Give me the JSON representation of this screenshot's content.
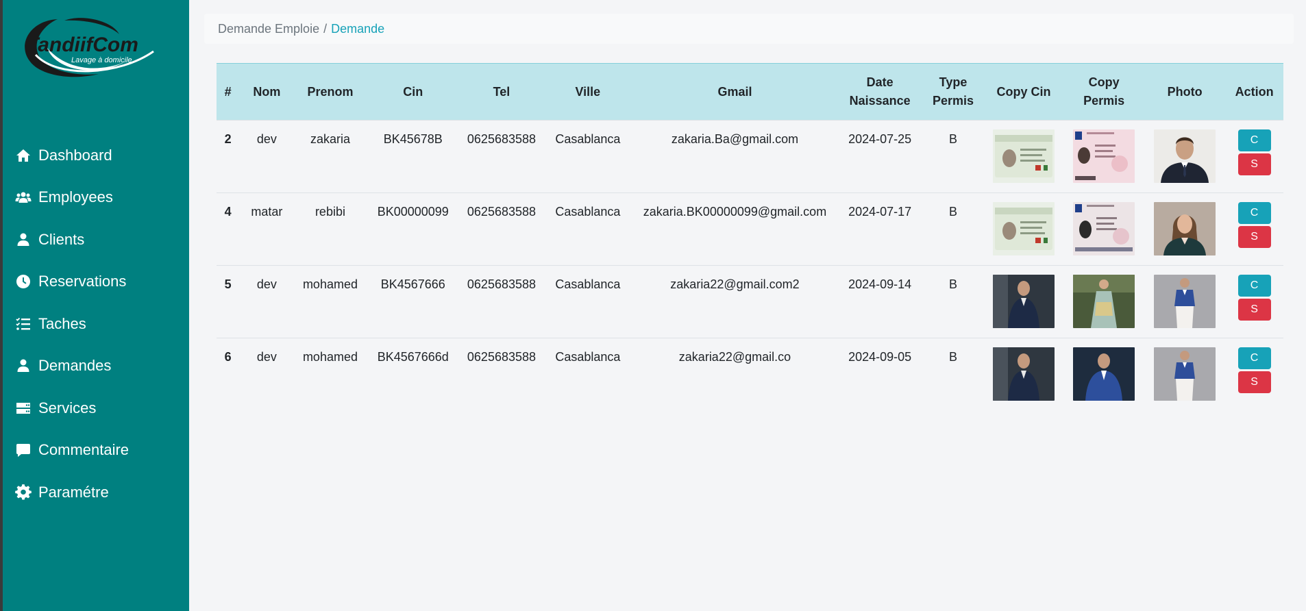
{
  "app": {
    "logo_text": "TandiifCom",
    "logo_tagline": "Lavage à domicile"
  },
  "sidebar": {
    "items": [
      {
        "label": "Dashboard",
        "icon": "home-icon"
      },
      {
        "label": "Employees",
        "icon": "users-icon"
      },
      {
        "label": "Clients",
        "icon": "user-icon"
      },
      {
        "label": "Reservations",
        "icon": "clock-icon"
      },
      {
        "label": "Taches",
        "icon": "tasks-icon"
      },
      {
        "label": "Demandes",
        "icon": "user-icon"
      },
      {
        "label": "Services",
        "icon": "server-icon"
      },
      {
        "label": "Commentaire",
        "icon": "comment-icon"
      },
      {
        "label": "Paramétre",
        "icon": "gear-icon"
      }
    ]
  },
  "breadcrumb": {
    "parent": "Demande Emploie",
    "separator": "/",
    "current": "Demande"
  },
  "table": {
    "headers": {
      "id": "#",
      "nom": "Nom",
      "prenom": "Prenom",
      "cin": "Cin",
      "tel": "Tel",
      "ville": "Ville",
      "gmail": "Gmail",
      "date_line1": "Date",
      "date_line2": "Naissance",
      "type_line1": "Type",
      "type_line2": "Permis",
      "copy_cin": "Copy Cin",
      "permis_line1": "Copy",
      "permis_line2": "Permis",
      "photo": "Photo",
      "action": "Action"
    },
    "rows": [
      {
        "id": "2",
        "nom": "dev",
        "prenom": "zakaria",
        "cin": "BK45678B",
        "tel": "0625683588",
        "ville": "Casablanca",
        "gmail": "zakaria.Ba@gmail.com",
        "date": "2024-07-25",
        "type": "B"
      },
      {
        "id": "4",
        "nom": "matar",
        "prenom": "rebibi",
        "cin": "BK00000099",
        "tel": "0625683588",
        "ville": "Casablanca",
        "gmail": "zakaria.BK00000099@gmail.com",
        "date": "2024-07-17",
        "type": "B"
      },
      {
        "id": "5",
        "nom": "dev",
        "prenom": "mohamed",
        "cin": "BK4567666",
        "tel": "0625683588",
        "ville": "Casablanca",
        "gmail": "zakaria22@gmail.com2",
        "date": "2024-09-14",
        "type": "B"
      },
      {
        "id": "6",
        "nom": "dev",
        "prenom": "mohamed",
        "cin": "BK4567666d",
        "tel": "0625683588",
        "ville": "Casablanca",
        "gmail": "zakaria22@gmail.co",
        "date": "2024-09-05",
        "type": "B"
      }
    ],
    "action_labels": {
      "confirm": "C",
      "delete": "S"
    }
  },
  "colors": {
    "sidebar": "#008080",
    "table_header": "#bee5eb",
    "btn_confirm": "#17a2b8",
    "btn_delete": "#dc3545",
    "breadcrumb_active": "#17a2b8"
  }
}
